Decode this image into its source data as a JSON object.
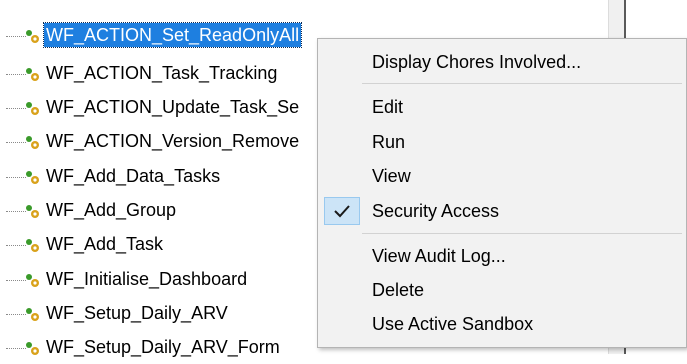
{
  "tree": {
    "items": [
      {
        "label": "WF_ACTION_Set_ReadOnlyAll",
        "selected": true
      },
      {
        "label": "WF_ACTION_Task_Tracking"
      },
      {
        "label": "WF_ACTION_Update_Task_Se"
      },
      {
        "label": "WF_ACTION_Version_Remove"
      },
      {
        "label": "WF_Add_Data_Tasks"
      },
      {
        "label": "WF_Add_Group"
      },
      {
        "label": "WF_Add_Task"
      },
      {
        "label": "WF_Initialise_Dashboard"
      },
      {
        "label": "WF_Setup_Daily_ARV"
      },
      {
        "label": "WF_Setup_Daily_ARV_Form"
      }
    ],
    "icon": "process-gear-icon"
  },
  "context_menu": {
    "items": [
      {
        "label": "Display Chores Involved..."
      },
      {
        "label": "Edit"
      },
      {
        "label": "Run"
      },
      {
        "label": "View"
      },
      {
        "label": "Security Access",
        "checked": true
      },
      {
        "label": "View Audit Log..."
      },
      {
        "label": "Delete"
      },
      {
        "label": "Use Active Sandbox"
      }
    ],
    "check_icon": "checkmark-icon"
  },
  "colors": {
    "selection": "#1e7fe0",
    "menu_bg": "#f2f2f2",
    "check_bg": "#cce4f7",
    "gear_green": "#3a9a2a",
    "gear_gold": "#d9a21b"
  }
}
